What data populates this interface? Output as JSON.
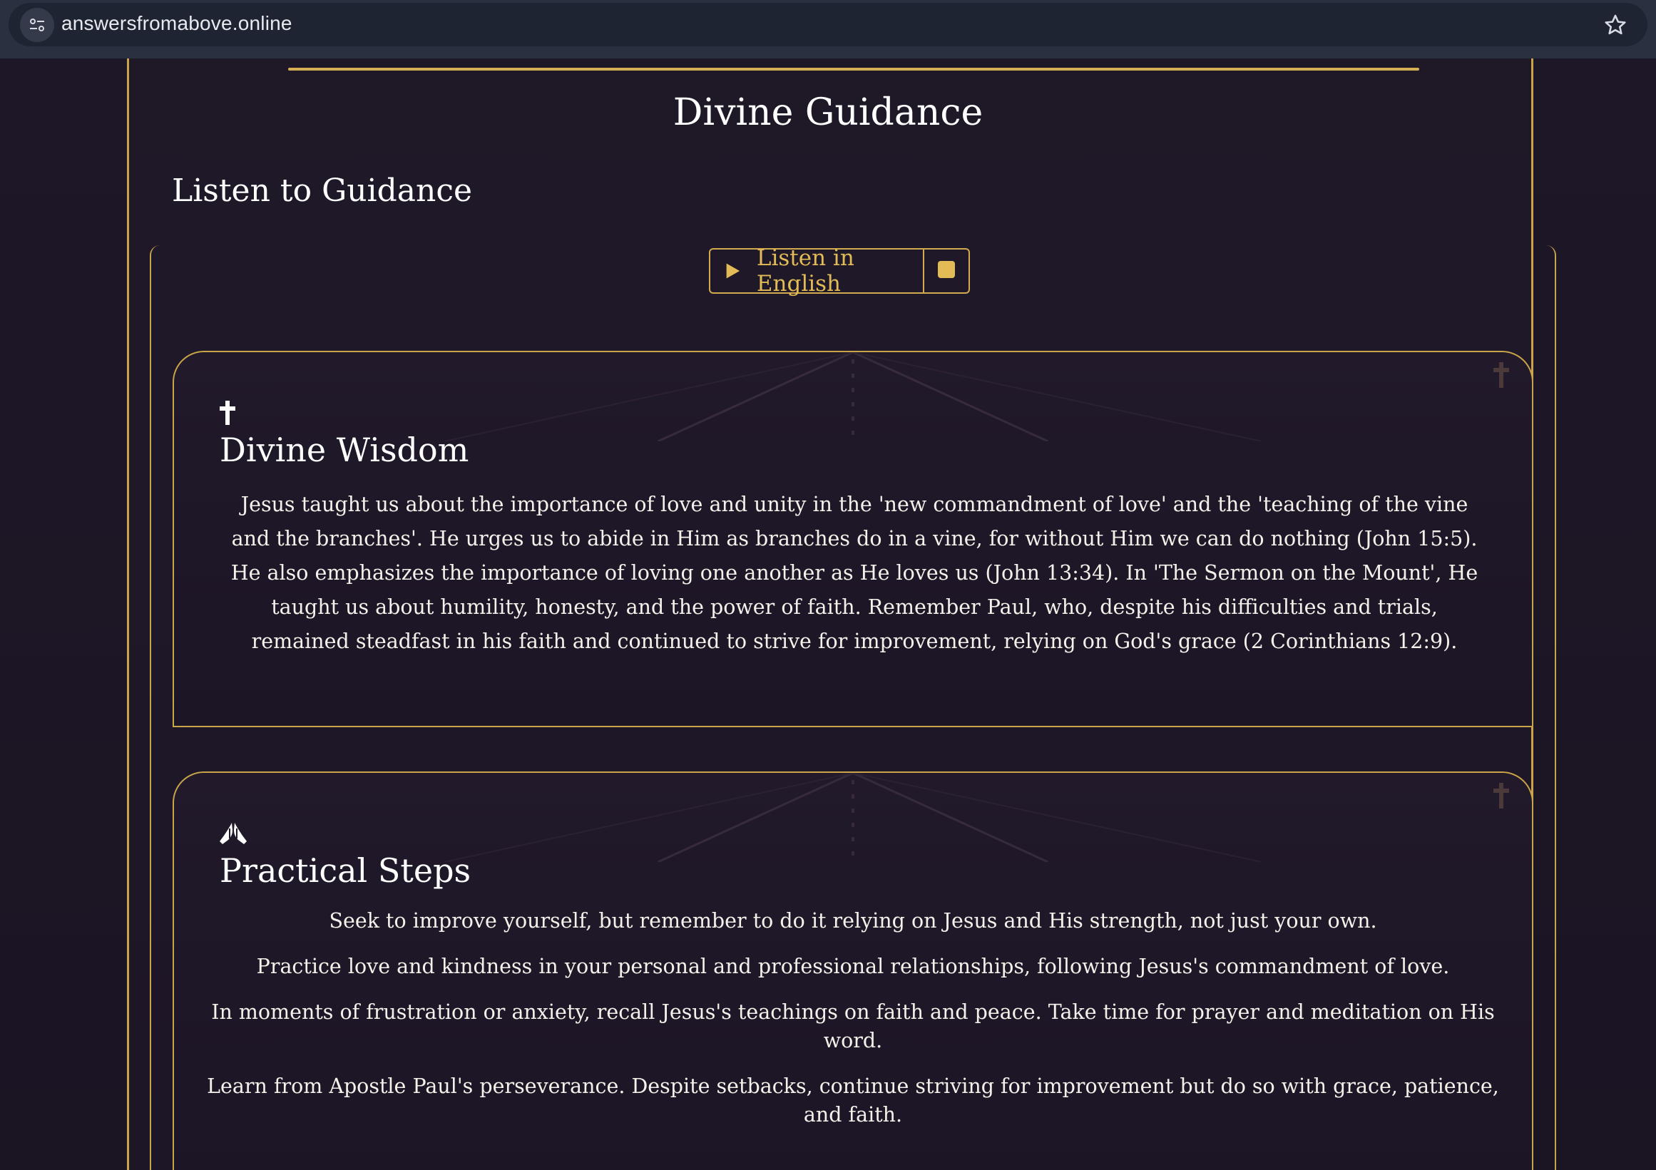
{
  "browser": {
    "url": "answersfromabove.online",
    "site_settings_icon": "tune-icon",
    "bookmark_icon": "star-icon"
  },
  "page": {
    "title": "Divine Guidance",
    "section_heading": "Listen to Guidance"
  },
  "audio": {
    "listen_label": "Listen in English",
    "play_icon": "play-icon",
    "stop_icon": "stop-icon"
  },
  "cards": {
    "wisdom": {
      "icon": "cross-icon",
      "title": "Divine Wisdom",
      "text": "Jesus taught us about the importance of love and unity in the 'new commandment of love' and the 'teaching of the vine and the branches'. He urges us to abide in Him as branches do in a vine, for without Him we can do nothing (John 15:5). He also emphasizes the importance of loving one another as He loves us (John 13:34). In 'The Sermon on the Mount', He taught us about humility, honesty, and the power of faith. Remember Paul, who, despite his difficulties and trials, remained steadfast in his faith and continued to strive for improvement, relying on God's grace (2 Corinthians 12:9)."
    },
    "steps": {
      "icon": "praying-hands-icon",
      "title": "Practical Steps",
      "items": [
        "Seek to improve yourself, but remember to do it relying on Jesus and His strength, not just your own.",
        "Practice love and kindness in your personal and professional relationships, following Jesus's commandment of love.",
        "In moments of frustration or anxiety, recall Jesus's teachings on faith and peace. Take time for prayer and meditation on His word.",
        "Learn from Apostle Paul's perseverance. Despite setbacks, continue striving for improvement but do so with grace, patience, and faith."
      ]
    }
  },
  "colors": {
    "accent_gold": "#c9a449",
    "button_gold": "#e2bb57",
    "background": "#1b1524",
    "text": "#f5f1ea"
  }
}
